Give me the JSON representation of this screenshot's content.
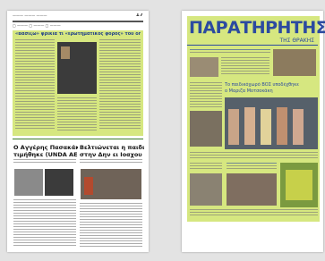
{
  "viewer": {
    "name": "document-spread"
  },
  "left_page": {
    "page_number": "17",
    "top_headline": "«Βασίζω» φρικιά τι «ερωτηματικός φόρος» του δήμου Ιουλίου",
    "article1_title": "Ο Αγγέρης Πασακάκης",
    "article1_subtitle": "τιμήθηκε (UNDA ΑΕ)",
    "article2_title": "Βελτιώνεται η παιδικη χαρά",
    "article2_subtitle": "στην Δην ει Ιοαχου"
  },
  "right_page": {
    "masthead": "ΠΑΡΑΤΗΡΗΤΗΣ",
    "masthead_sub": "ΤΗΣ ΘΡΑΚΗΣ",
    "mid_headline": "Το παιδικόχωρό ΒΟΣ υποδέχθηκε",
    "mid_headline2": "ο Μαριζα Μοτσοκάκη"
  },
  "colors": {
    "highlight": "#cfe36a",
    "masthead": "#2b4aa0",
    "background": "#e3e3e3"
  }
}
